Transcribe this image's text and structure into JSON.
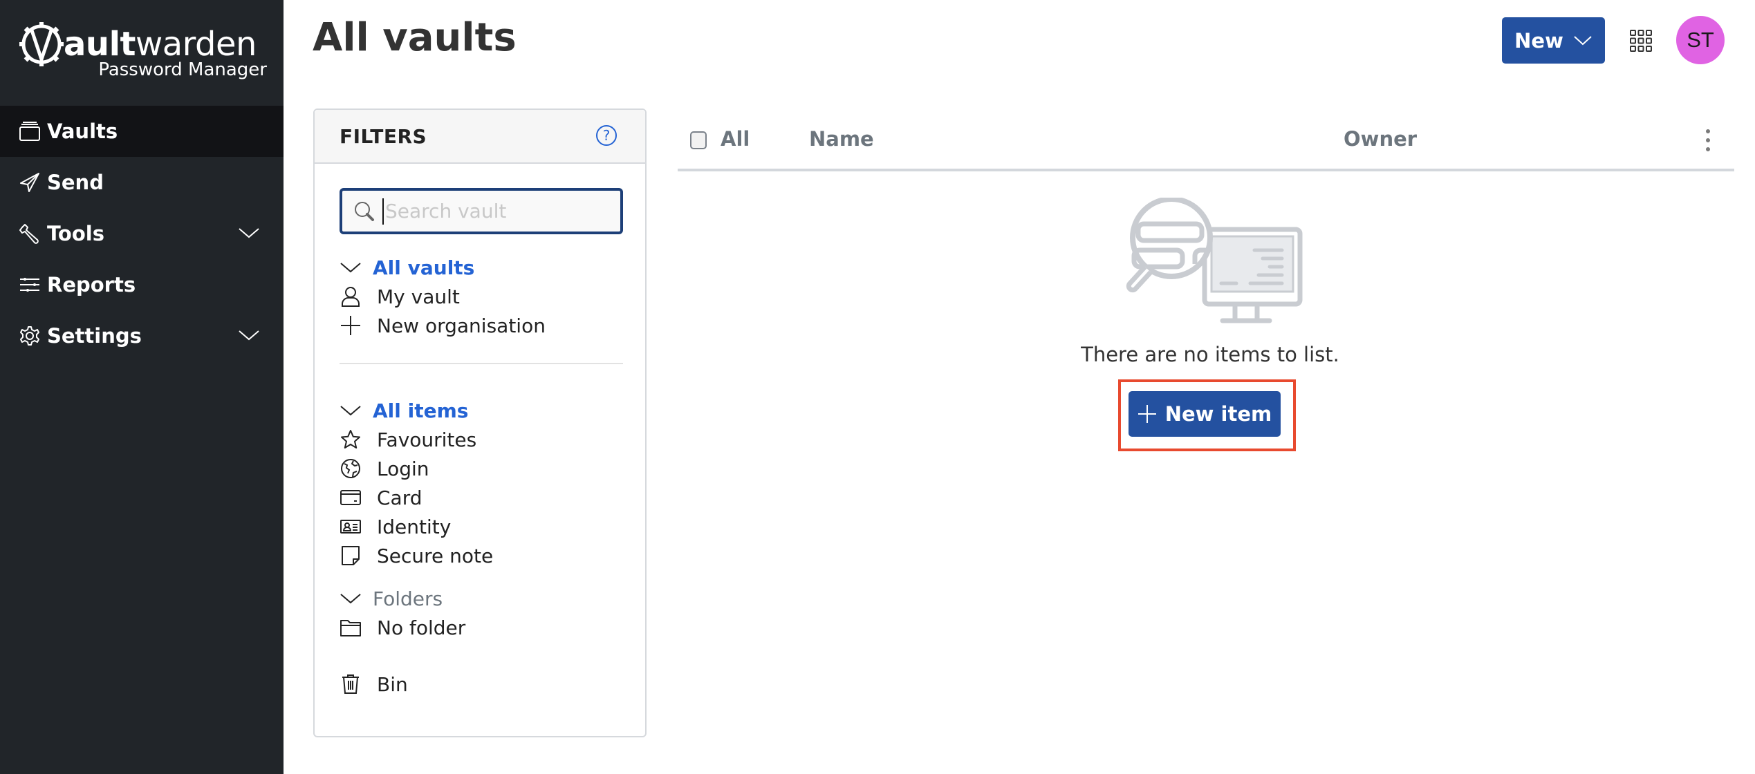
{
  "brand": {
    "name_bold": "ault",
    "name_light": "warden",
    "subtitle": "Password Manager"
  },
  "sidebar": {
    "items": [
      {
        "label": "Vaults",
        "icon": "vault-icon",
        "active": true,
        "expandable": false
      },
      {
        "label": "Send",
        "icon": "paper-plane-icon",
        "active": false,
        "expandable": false
      },
      {
        "label": "Tools",
        "icon": "wrench-icon",
        "active": false,
        "expandable": true
      },
      {
        "label": "Reports",
        "icon": "sliders-icon",
        "active": false,
        "expandable": false
      },
      {
        "label": "Settings",
        "icon": "gear-icon",
        "active": false,
        "expandable": true
      }
    ]
  },
  "header": {
    "title": "All vaults",
    "new_button": "New",
    "avatar_initials": "ST",
    "avatar_color": "#e063e3"
  },
  "filters": {
    "title": "FILTERS",
    "search_placeholder": "Search vault",
    "search_value": "",
    "vaults_section": {
      "heading": "All vaults",
      "items": [
        {
          "label": "My vault",
          "icon": "user-icon"
        },
        {
          "label": "New organisation",
          "icon": "plus-icon"
        }
      ]
    },
    "items_section": {
      "heading": "All items",
      "items": [
        {
          "label": "Favourites",
          "icon": "star-icon"
        },
        {
          "label": "Login",
          "icon": "globe-icon"
        },
        {
          "label": "Card",
          "icon": "credit-card-icon"
        },
        {
          "label": "Identity",
          "icon": "id-card-icon"
        },
        {
          "label": "Secure note",
          "icon": "sticky-note-icon"
        }
      ]
    },
    "folders_section": {
      "heading": "Folders",
      "items": [
        {
          "label": "No folder",
          "icon": "folder-icon"
        }
      ]
    },
    "bin": {
      "label": "Bin",
      "icon": "trash-icon"
    }
  },
  "table": {
    "select_all_label": "All",
    "columns": [
      "Name",
      "Owner"
    ],
    "rows": []
  },
  "empty_state": {
    "message": "There are no items to list.",
    "button_label": "New item"
  },
  "colors": {
    "sidebar_bg": "#212529",
    "sidebar_active": "#121316",
    "primary": "#2451a0",
    "link": "#2463d4",
    "highlight": "#e84a2f"
  }
}
